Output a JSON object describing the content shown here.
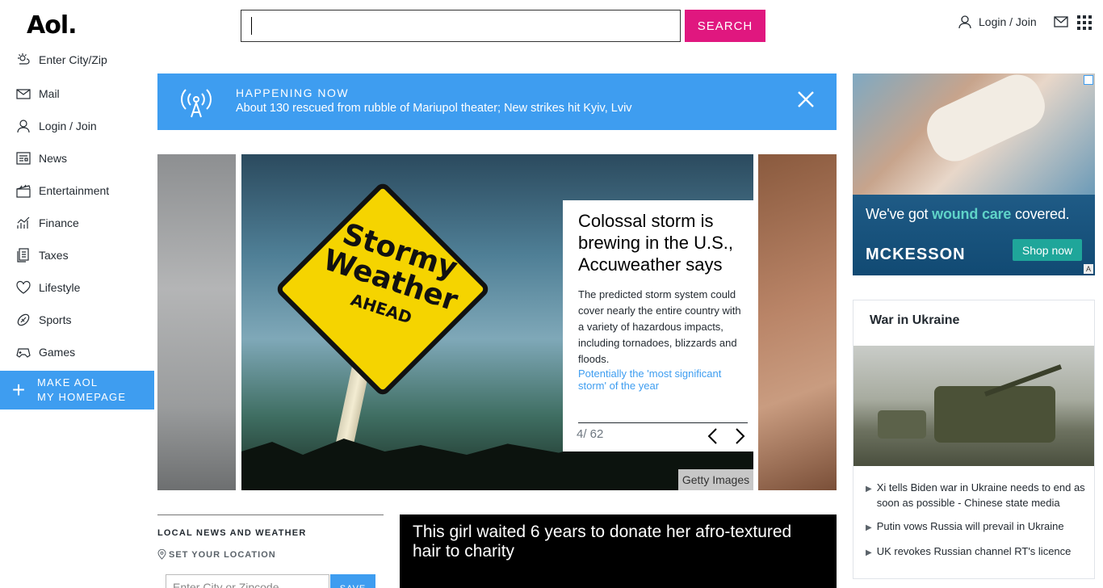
{
  "header": {
    "logo": "Aol.",
    "search_value": "",
    "search_button": "SEARCH",
    "login_label": "Login / Join"
  },
  "sidebar": {
    "items": [
      {
        "label": "Enter City/Zip",
        "icon": "weather-icon"
      },
      {
        "label": "Mail",
        "icon": "mail-icon"
      },
      {
        "label": "Login / Join",
        "icon": "user-icon"
      },
      {
        "label": "News",
        "icon": "news-icon"
      },
      {
        "label": "Entertainment",
        "icon": "clapperboard-icon"
      },
      {
        "label": "Finance",
        "icon": "chart-icon"
      },
      {
        "label": "Taxes",
        "icon": "document-icon"
      },
      {
        "label": "Lifestyle",
        "icon": "heart-icon"
      },
      {
        "label": "Sports",
        "icon": "football-icon"
      },
      {
        "label": "Games",
        "icon": "gamepad-icon"
      }
    ],
    "make_home": {
      "line1": "MAKE AOL",
      "line2": "MY HOMEPAGE"
    }
  },
  "happening": {
    "label": "HAPPENING NOW",
    "headline": "About 130 rescued from rubble of Mariupol theater; New strikes hit Kyiv, Lviv"
  },
  "carousel": {
    "sign": {
      "line1": "Stormy",
      "line2": "Weather",
      "line3": "AHEAD"
    },
    "title": "Colossal storm is brewing in the U.S., Accuweather says",
    "summary": "The predicted storm system could cover nearly the entire country with a variety of hazardous impacts, including tornadoes, blizzards and floods.",
    "link": "Potentially the 'most significant storm' of the year",
    "counter": "4/ 62",
    "credit": "Getty Images"
  },
  "local": {
    "title": "LOCAL NEWS AND WEATHER",
    "set_location": "SET YOUR LOCATION",
    "zip_placeholder": "Enter City or Zipcode",
    "save": "SAVE"
  },
  "video": {
    "title": "This girl waited 6 years to donate her afro-textured hair to charity"
  },
  "ad": {
    "tagline_pre": "We've got ",
    "tagline_em": "wound care",
    "tagline_post": " covered.",
    "brand": "MCKESSON",
    "cta": "Shop now"
  },
  "ukraine": {
    "title": "War in Ukraine",
    "items": [
      "Xi tells Biden war in Ukraine needs to end as soon as possible - Chinese state media",
      "Putin vows Russia will prevail in Ukraine",
      "UK revokes Russian channel RT's licence"
    ]
  },
  "colors": {
    "accent_blue": "#3e9df0",
    "search_pink": "#e0177f"
  }
}
